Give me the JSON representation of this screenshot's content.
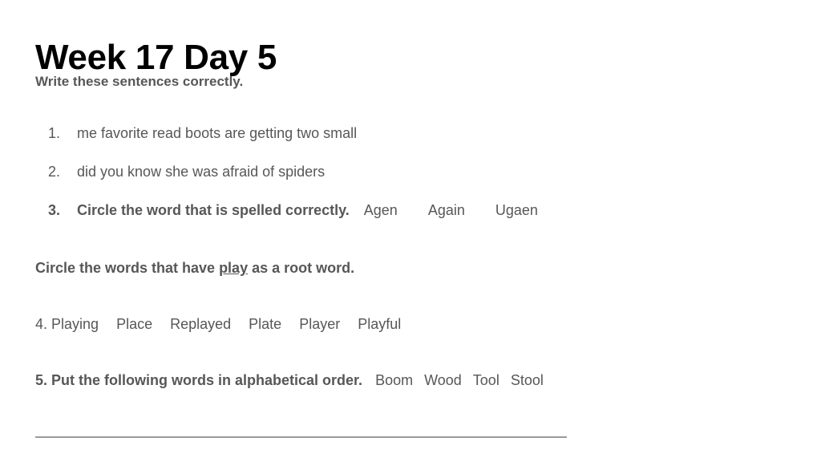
{
  "slide": {
    "title": "Week 17 Day 5",
    "instruction": "Write these sentences correctly.",
    "numbered_items": [
      {
        "marker": "1.",
        "text": "me favorite read boots are getting two small",
        "bold": false,
        "choices": []
      },
      {
        "marker": "2.",
        "text": "did you know she was afraid of spiders",
        "bold": false,
        "choices": []
      },
      {
        "marker": "3.",
        "text": "Circle the word that is spelled correctly.",
        "bold": true,
        "choices": [
          "Agen",
          "Again",
          "Ugaen"
        ]
      }
    ],
    "root_word_prompt": {
      "before": "Circle the words that have ",
      "root_word": "play",
      "after": " as a root word."
    },
    "line4": {
      "marker": "4.",
      "words": [
        "Playing",
        "Place",
        "Replayed",
        "Plate",
        "Player",
        "Playful"
      ]
    },
    "line5": {
      "lead": "5. Put the following words in alphabetical order.",
      "words": [
        "Boom",
        "Wood",
        "Tool",
        "Stool"
      ]
    },
    "answer_line": "________________________________________________________",
    "colors": {
      "title": "#000000",
      "body_text": "#575757",
      "rule": "#9a9a9a",
      "background": "#ffffff"
    }
  }
}
